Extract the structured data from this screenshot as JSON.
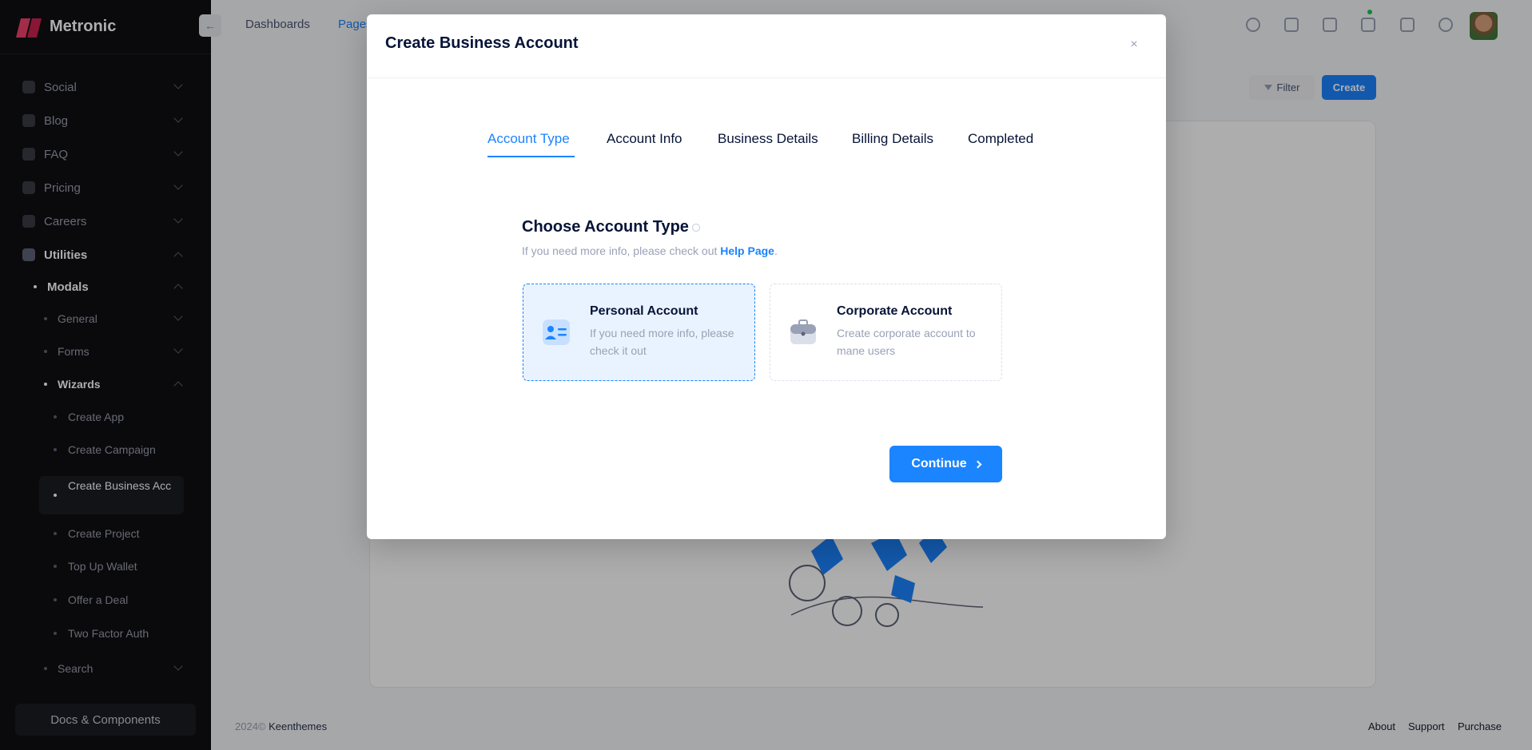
{
  "brand": {
    "name": "Metronic"
  },
  "sidebar": {
    "items": [
      {
        "label": "Social",
        "icon": "social-icon"
      },
      {
        "label": "Blog",
        "icon": "blog-icon"
      },
      {
        "label": "FAQ",
        "icon": "faq-icon"
      },
      {
        "label": "Pricing",
        "icon": "pricing-icon"
      },
      {
        "label": "Careers",
        "icon": "careers-icon"
      },
      {
        "label": "Utilities",
        "icon": "utilities-icon"
      }
    ],
    "modals": "Modals",
    "modals_children": [
      "General",
      "Forms",
      "Wizards"
    ],
    "wizards_children": [
      "Create App",
      "Create Campaign",
      "Create Business Acc",
      "Create Project",
      "Top Up Wallet",
      "Offer a Deal",
      "Two Factor Auth"
    ],
    "search": "Search",
    "docs_button": "Docs & Components"
  },
  "header": {
    "toggle_icon": "←",
    "menu": [
      "Dashboards",
      "Pages"
    ]
  },
  "toolbar": {
    "filter": "Filter",
    "create": "Create"
  },
  "footer": {
    "year": "2024©",
    "company": "Keenthemes",
    "links": [
      "About",
      "Support",
      "Purchase"
    ]
  },
  "modal": {
    "title": "Create Business Account",
    "close": "×",
    "steps": [
      "Account Type",
      "Account Info",
      "Business Details",
      "Billing Details",
      "Completed"
    ],
    "section_title": "Choose Account Type",
    "section_sub_prefix": "If you need more info, please check out ",
    "help_link": "Help Page",
    "section_sub_suffix": ".",
    "accounts": [
      {
        "title": "Personal Account",
        "desc": "If you need more info, please check it out"
      },
      {
        "title": "Corporate Account",
        "desc": "Create corporate account to mane users"
      }
    ],
    "continue": "Continue"
  },
  "colors": {
    "primary": "#1b84ff",
    "sidebar": "#0f0f13",
    "brand": "#f1416c"
  }
}
